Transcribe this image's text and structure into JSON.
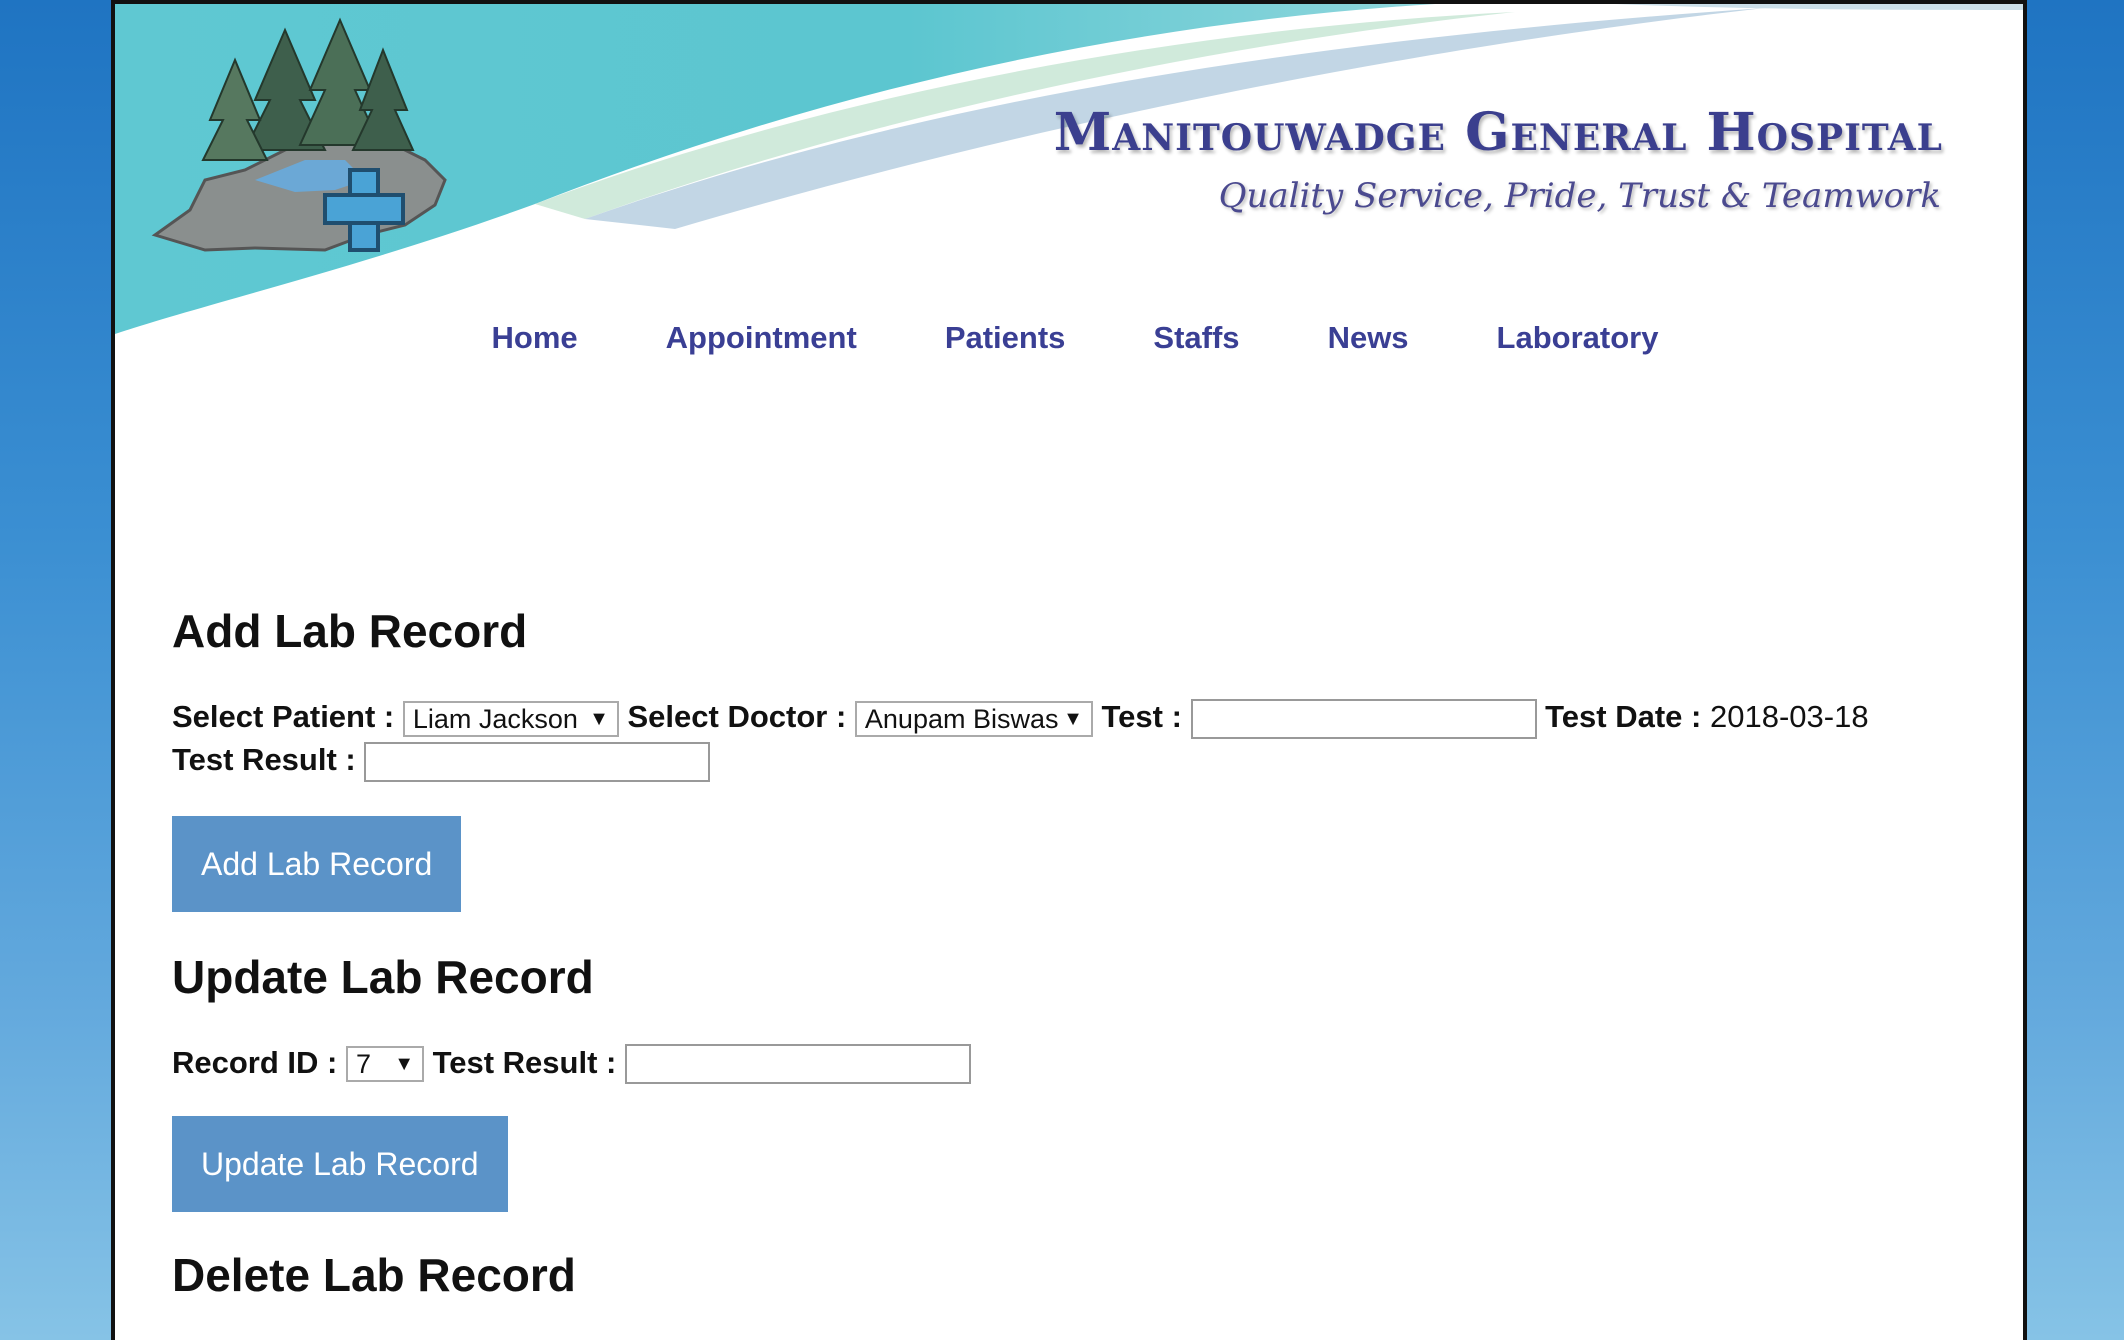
{
  "header": {
    "hospital_name": "Manitouwadge General Hospital",
    "tagline": "Quality Service, Pride, Trust & Teamwork"
  },
  "nav": {
    "items": [
      {
        "label": "Home"
      },
      {
        "label": "Appointment"
      },
      {
        "label": "Patients"
      },
      {
        "label": "Staffs"
      },
      {
        "label": "News"
      },
      {
        "label": "Laboratory"
      }
    ]
  },
  "add_section": {
    "title": "Add Lab Record",
    "patient_label": "Select Patient :",
    "patient_value": "Liam Jackson",
    "doctor_label": "Select Doctor :",
    "doctor_value": "Anupam Biswas",
    "test_label": "Test :",
    "test_value": "",
    "date_label": "Test Date :",
    "date_value": "2018-03-18",
    "result_label": "Test Result :",
    "result_value": "",
    "button_label": "Add Lab Record"
  },
  "update_section": {
    "title": "Update Lab Record",
    "record_id_label": "Record ID :",
    "record_id_value": "7",
    "result_label": "Test Result :",
    "result_value": "",
    "button_label": "Update Lab Record"
  },
  "delete_section": {
    "title": "Delete Lab Record"
  },
  "icons": {
    "dropdown": "chevron-down-icon",
    "logo": "tree-cross-logo"
  },
  "colors": {
    "nav_link": "#3a3f94",
    "button_bg": "#5b93c8",
    "banner_teal": "#56c3cf"
  }
}
